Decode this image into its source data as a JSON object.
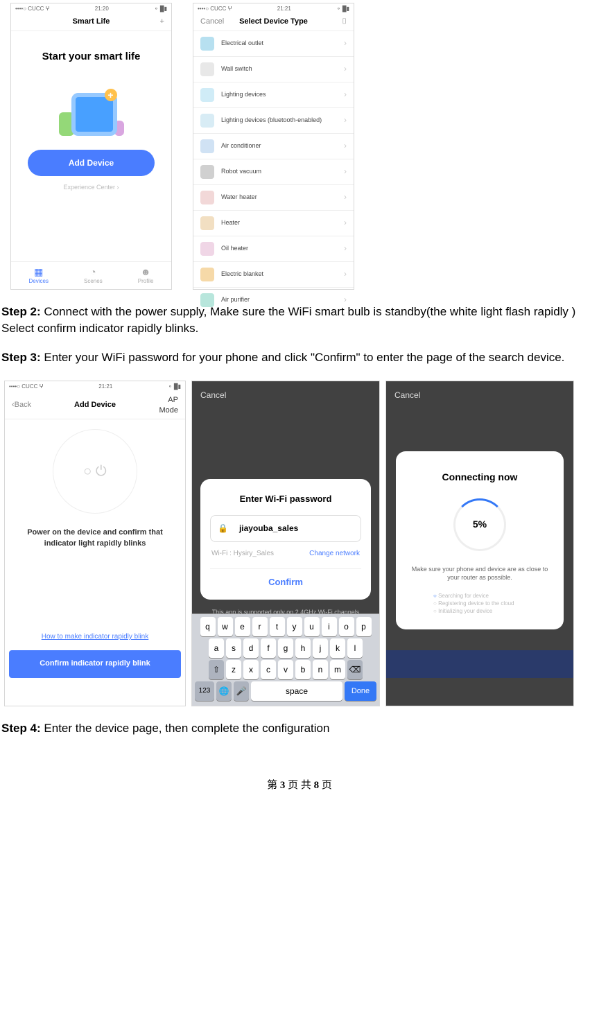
{
  "status": {
    "carrier": "CUCC",
    "time1": "21:20",
    "time2": "21:21"
  },
  "screen1": {
    "title": "Smart Life",
    "plus": "+",
    "banner": "Start your smart life",
    "add_button": "Add Device",
    "experience": "Experience Center ›",
    "tabs": {
      "devices": "Devices",
      "scenes": "Scenes",
      "profile": "Profile"
    }
  },
  "screen2": {
    "cancel": "Cancel",
    "title": "Select Device Type",
    "scan": "⌷",
    "items": [
      {
        "label": "Electrical outlet",
        "color": "#b7e0f0"
      },
      {
        "label": "Wall switch",
        "color": "#e8e8e8"
      },
      {
        "label": "Lighting devices",
        "color": "#d0ecf7"
      },
      {
        "label": "Lighting devices (bluetooth-enabled)",
        "color": "#d8ecf5"
      },
      {
        "label": "Air conditioner",
        "color": "#d0e2f4"
      },
      {
        "label": "Robot vacuum",
        "color": "#d0d0d0"
      },
      {
        "label": "Water heater",
        "color": "#f2d8d8"
      },
      {
        "label": "Heater",
        "color": "#f2dfc2"
      },
      {
        "label": "Oil heater",
        "color": "#f0d6e6"
      },
      {
        "label": "Electric blanket",
        "color": "#f6d9a8"
      },
      {
        "label": "Air purifier",
        "color": "#b8e6dc"
      }
    ]
  },
  "step2": {
    "label": "Step 2:",
    "text": " Connect with the power supply, Make sure the WiFi smart bulb is standby(the white light flash rapidly ) Select confirm indicator rapidly blinks."
  },
  "step3": {
    "label": "Step 3:",
    "text": " Enter your WiFi password for your phone and click \"Confirm\" to enter the page of the search device."
  },
  "screen3": {
    "back": "Back",
    "title": "Add Device",
    "mode": "AP Mode",
    "confirm_text": "Power on the device and confirm that indicator light rapidly blinks",
    "help": "How to make indicator rapidly blink",
    "button": "Confirm indicator rapidly blink"
  },
  "screen4": {
    "cancel": "Cancel",
    "card_title": "Enter Wi-Fi password",
    "ssid": "jiayouba_sales",
    "wifi_label": "Wi-Fi : Hysiry_Sales",
    "change": "Change network",
    "confirm": "Confirm",
    "hint": "This app is supported only on 2.4GHz Wi-Fi channels",
    "keys": {
      "r1": [
        "q",
        "w",
        "e",
        "r",
        "t",
        "y",
        "u",
        "i",
        "o",
        "p"
      ],
      "r2": [
        "a",
        "s",
        "d",
        "f",
        "g",
        "h",
        "j",
        "k",
        "l"
      ],
      "r3": [
        "z",
        "x",
        "c",
        "v",
        "b",
        "n",
        "m"
      ],
      "num": "123",
      "space": "space",
      "done": "Done"
    }
  },
  "screen5": {
    "cancel": "Cancel",
    "title": "Connecting now",
    "percent": "5%",
    "sub": "Make sure your phone and device are as close to your router as possible.",
    "steps": [
      "Searching for device",
      "Registering device to the cloud",
      "Initializing your device"
    ]
  },
  "step4": {
    "label": "Step 4:",
    "text": " Enter the device page, then complete the configuration"
  },
  "footer": {
    "prefix": "第 ",
    "page": "3",
    "mid": " 页    共 ",
    "total": "8",
    "suffix": " 页"
  }
}
